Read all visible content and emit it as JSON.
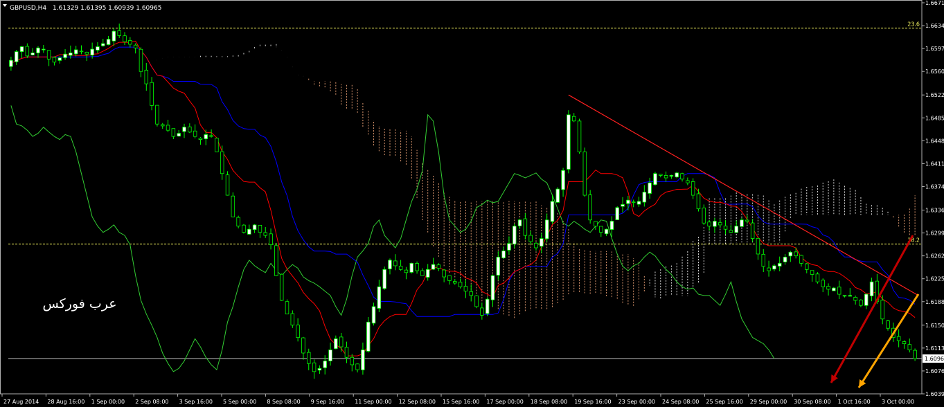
{
  "window": {
    "symbol_header": "GBPUSD,H4",
    "ohlc_text": "1.61329 1.61395 1.60939 1.60965",
    "watermark": "عرب فوركس"
  },
  "colors": {
    "background": "#000000",
    "frame": "#b0b0b0",
    "candle_bull": "#ffffff",
    "candle_bear": "#000000",
    "candle_outline": "#00ff00",
    "tenkan": "#ff0000",
    "kijun": "#0000ff",
    "chikou": "#32cd32",
    "kumo_a": "#ffffff",
    "kumo_b": "#ffb080",
    "fibo": "#ffff66",
    "trendline": "#ff2020",
    "arrow_red": "#c00000",
    "arrow_orange": "#ffa500",
    "current_price_line": "#c0c0c0"
  },
  "chart_data": {
    "type": "candlestick",
    "symbol": "GBPUSD",
    "timeframe": "H4",
    "ylim": [
      1.6039,
      1.6671
    ],
    "y_ticks": [
      "1.6671",
      "1.6634",
      "1.6597",
      "1.6560",
      "1.6522",
      "1.6485",
      "1.6448",
      "1.6411",
      "1.6374",
      "1.6336",
      "1.6299",
      "1.6262",
      "1.6225",
      "1.6188",
      "1.6150",
      "1.6113",
      "1.6076",
      "1.6039"
    ],
    "x_ticks": [
      "27 Aug 2014",
      "28 Aug 16:00",
      "1 Sep 00:00",
      "2 Sep 08:00",
      "3 Sep 16:00",
      "5 Sep 00:00",
      "8 Sep 08:00",
      "9 Sep 16:00",
      "11 Sep 00:00",
      "12 Sep 08:00",
      "15 Sep 16:00",
      "17 Sep 00:00",
      "18 Sep 08:00",
      "19 Sep 16:00",
      "23 Sep 00:00",
      "24 Sep 08:00",
      "25 Sep 16:00",
      "29 Sep 00:00",
      "30 Sep 08:00",
      "1 Oct 16:00",
      "3 Oct 00:00"
    ],
    "current_price": "1.6096",
    "fibo_levels": [
      {
        "label": "23.6",
        "price": 1.663
      },
      {
        "label": "38.2",
        "price": 1.6281
      }
    ],
    "candles_close": [
      1.6578,
      1.6592,
      1.66,
      1.6585,
      1.659,
      1.6598,
      1.6596,
      1.658,
      1.6575,
      1.6582,
      1.6588,
      1.659,
      1.6595,
      1.6592,
      1.6588,
      1.6596,
      1.66,
      1.6605,
      1.6612,
      1.6625,
      1.6618,
      1.6608,
      1.6604,
      1.6598,
      1.656,
      1.654,
      1.6505,
      1.6475,
      1.6472,
      1.6465,
      1.6455,
      1.646,
      1.647,
      1.6462,
      1.6455,
      1.645,
      1.6458,
      1.6455,
      1.643,
      1.6395,
      1.636,
      1.6325,
      1.631,
      1.63,
      1.6305,
      1.6312,
      1.63,
      1.6295,
      1.628,
      1.623,
      1.619,
      1.6168,
      1.615,
      1.613,
      1.6105,
      1.6088,
      1.6075,
      1.608,
      1.6092,
      1.611,
      1.6128,
      1.6115,
      1.6098,
      1.6086,
      1.6078,
      1.611,
      1.6155,
      1.618,
      1.6212,
      1.624,
      1.6255,
      1.6246,
      1.624,
      1.6235,
      1.625,
      1.6238,
      1.623,
      1.624,
      1.6248,
      1.6242,
      1.6228,
      1.6222,
      1.6218,
      1.6212,
      1.6205,
      1.6198,
      1.618,
      1.6166,
      1.6192,
      1.623,
      1.626,
      1.627,
      1.6282,
      1.631,
      1.632,
      1.6295,
      1.6285,
      1.6275,
      1.629,
      1.632,
      1.635,
      1.637,
      1.64,
      1.649,
      1.648,
      1.643,
      1.636,
      1.632,
      1.631,
      1.63,
      1.6305,
      1.6318,
      1.634,
      1.6345,
      1.6352,
      1.6348,
      1.635,
      1.6365,
      1.638,
      1.6395,
      1.6392,
      1.6388,
      1.6392,
      1.6396,
      1.6386,
      1.638,
      1.636,
      1.6338,
      1.6315,
      1.631,
      1.6318,
      1.6312,
      1.6305,
      1.63,
      1.631,
      1.632,
      1.6318,
      1.629,
      1.6265,
      1.6245,
      1.6238,
      1.6246,
      1.625,
      1.626,
      1.6268,
      1.6262,
      1.625,
      1.624,
      1.6232,
      1.622,
      1.6212,
      1.6208,
      1.621,
      1.62,
      1.6198,
      1.6198,
      1.619,
      1.6182,
      1.62,
      1.622,
      1.6188,
      1.616,
      1.6145,
      1.613,
      1.6125,
      1.612,
      1.611,
      1.6096
    ]
  }
}
